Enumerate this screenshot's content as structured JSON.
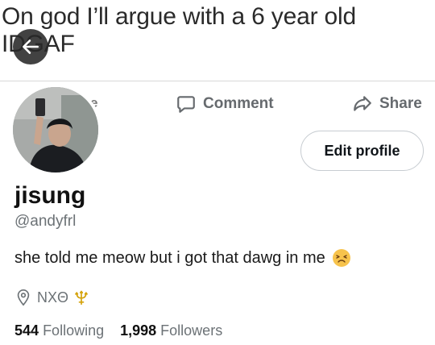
{
  "post": {
    "line1": "On god I’ll argue with a 6 year old",
    "line2": "IDGAF"
  },
  "actions": {
    "like_partial": "e",
    "comment_label": "Comment",
    "share_label": "Share"
  },
  "profile": {
    "display_name": "jisung",
    "handle": "@andyfrl",
    "bio": "she told me meow but i got that dawg in me",
    "bio_emoji": "persevering-face",
    "location": "NXΘ",
    "location_emoji": "trident-emblem",
    "edit_button_label": "Edit profile",
    "following_count": "544",
    "following_label": "Following",
    "followers_count": "1,998",
    "followers_label": "Followers"
  },
  "icons": {
    "back": "arrow-left-icon",
    "comment": "speech-bubble-icon",
    "share": "share-arrow-icon",
    "location": "map-pin-icon"
  },
  "colors": {
    "muted_text": "#6c7276",
    "primary_text": "#0f1419",
    "button_border": "#c7ccd1"
  }
}
